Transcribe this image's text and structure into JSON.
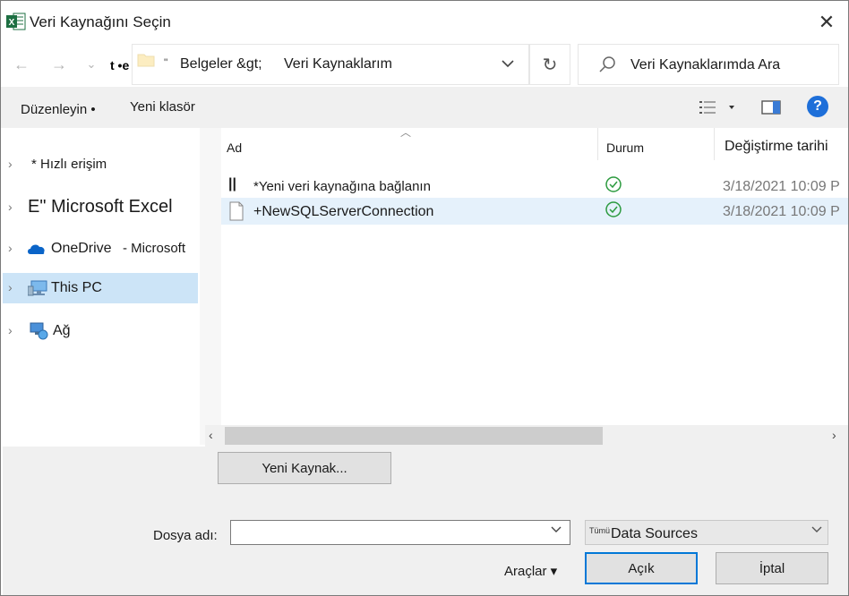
{
  "window": {
    "title": "Veri Kaynağını Seçin",
    "close_glyph": "✕"
  },
  "navigation": {
    "back_glyph": "←",
    "forward_glyph": "→",
    "recent_glyph": "⌄",
    "address_prefix": "t •e",
    "address_quote": "\"",
    "breadcrumbs": [
      "Belgeler &gt;",
      "Veri Kaynaklarım"
    ],
    "dropdown_glyph": "⌄",
    "refresh_glyph": "↻",
    "search_placeholder": "Veri Kaynaklarımda Ara"
  },
  "toolbar": {
    "organize_label": "Düzenleyin •",
    "new_folder_label": "Yeni klasör",
    "help_glyph": "?"
  },
  "sidebar": {
    "chevron": "›",
    "items": [
      {
        "label": "* Hızlı erişim",
        "icon": "star-icon"
      },
      {
        "label": "E\" Microsoft Excel",
        "icon": "excel-icon"
      },
      {
        "label": "OneDrive",
        "label_suffix": "- Microsoft",
        "icon": "cloud-icon"
      },
      {
        "label": "This PC",
        "icon": "computer-icon",
        "selected": true
      },
      {
        "label": "Ağ",
        "icon": "network-icon"
      }
    ]
  },
  "file_list": {
    "sort_glyph": "︿",
    "columns": [
      "Ad",
      "Durum",
      "Değiştirme tarihi"
    ],
    "rows": [
      {
        "icon_glyph": "||",
        "name": "*Yeni veri kaynağına bağlanın",
        "status": "synced",
        "date": "3/18/2021 10:09 P"
      },
      {
        "icon_glyph": "",
        "name": "+NewSQLServerConnection",
        "status": "synced",
        "date": "3/18/2021 10:09 P",
        "selected": true
      }
    ]
  },
  "scrollbar": {
    "left_glyph": "‹",
    "right_glyph": "›"
  },
  "bottom": {
    "new_source_button": "Yeni Kaynak...",
    "file_name_label": "Dosya adı:",
    "file_name_value": "",
    "filter_prefix": "Tümü",
    "filter_value": "Data Sources",
    "tools_label": "Araçlar ▾",
    "open_button": "Açık",
    "cancel_button": "İptal"
  },
  "colors": {
    "selection": "#cce4f7",
    "accent": "#0078d7",
    "excel_green": "#1d6f42",
    "status_green": "#2b9a3e"
  }
}
